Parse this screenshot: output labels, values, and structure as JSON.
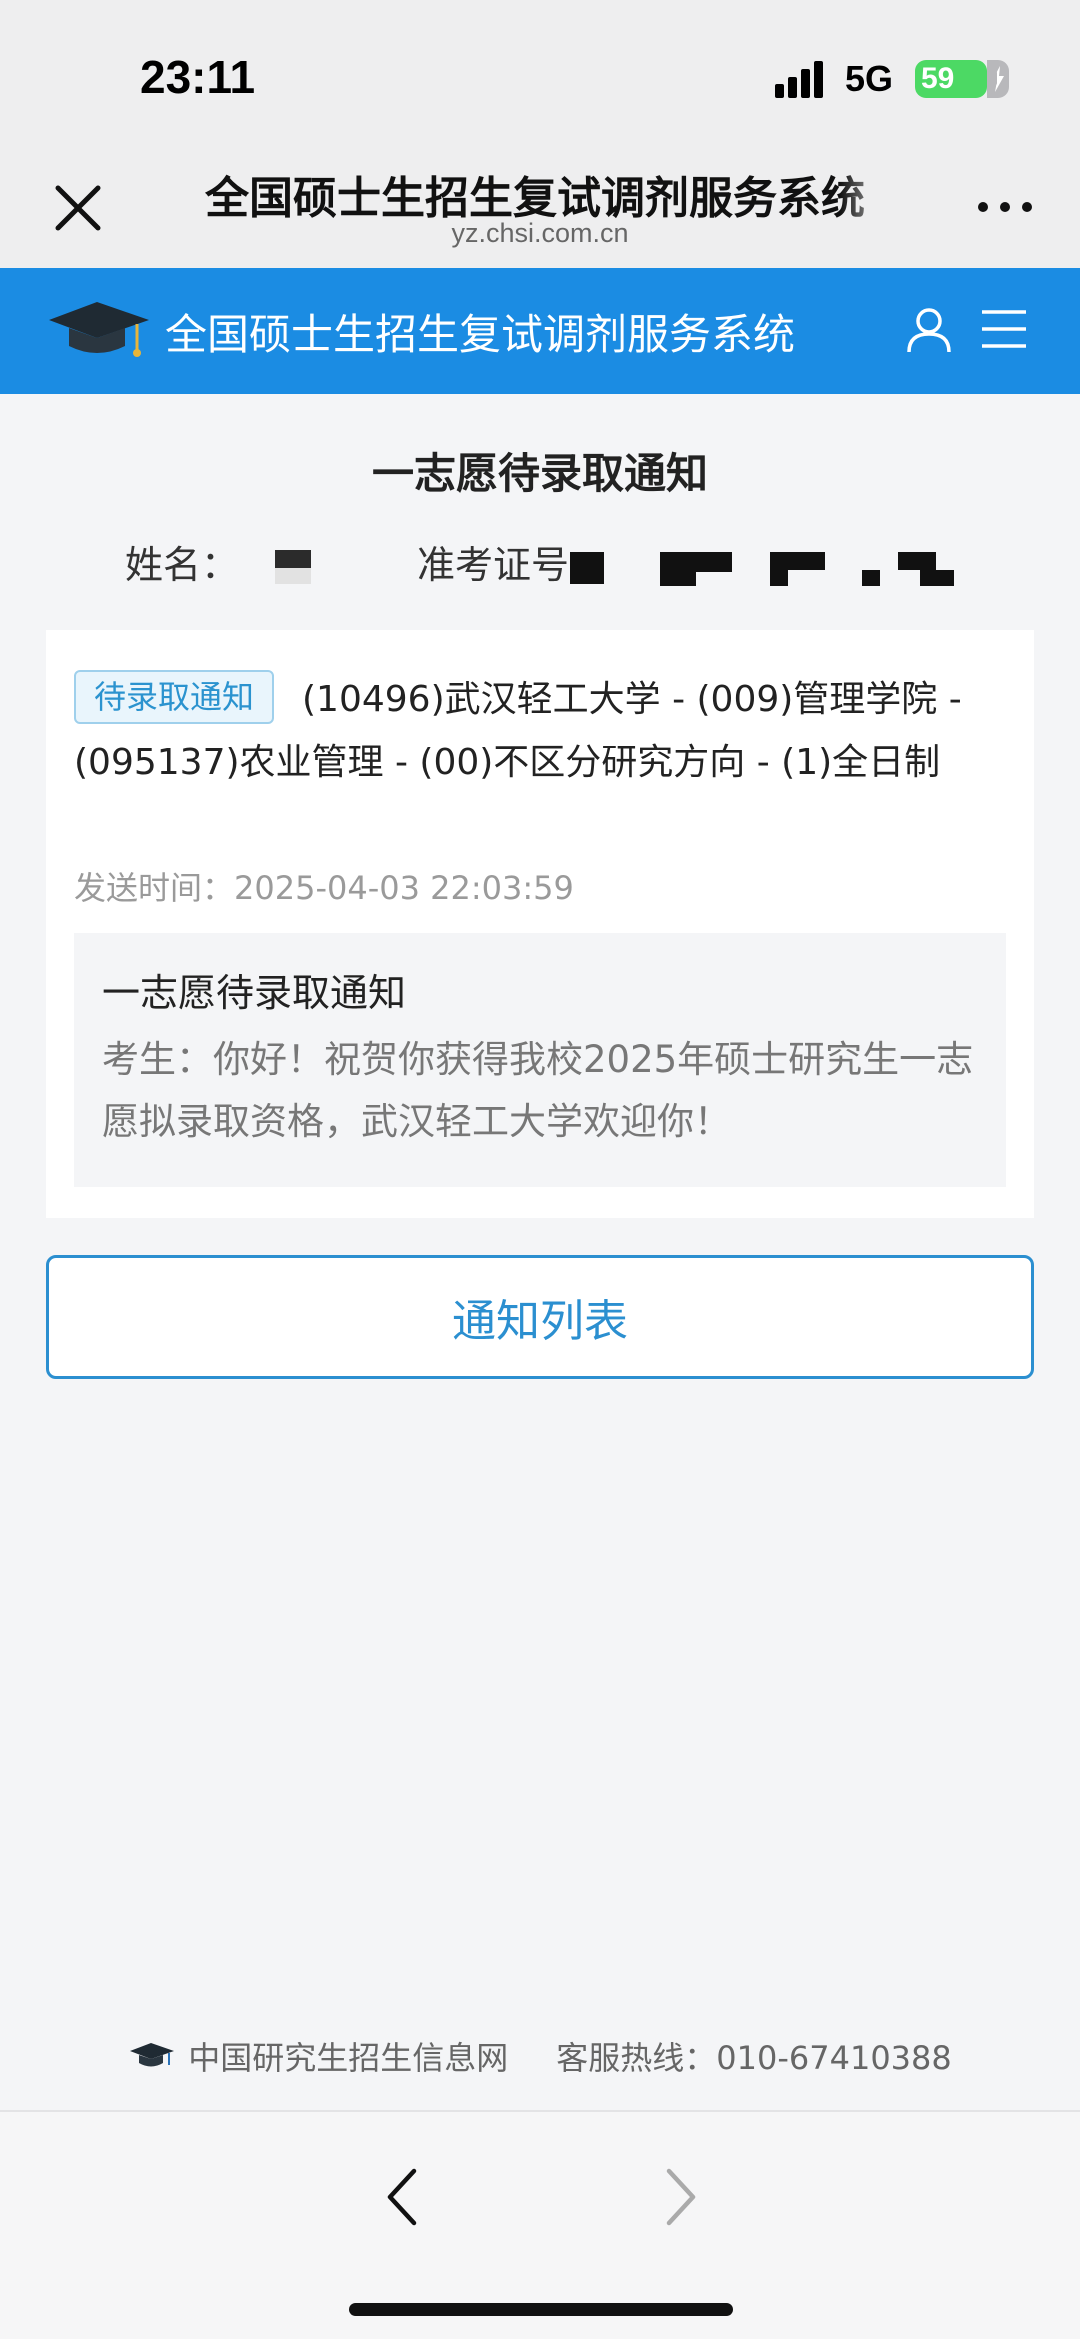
{
  "status_bar": {
    "time": "23:11",
    "network": "5G",
    "battery_level": "59",
    "signal_icon": "signal-bars-icon",
    "battery_color": "#4cd964"
  },
  "webview": {
    "title": "全国硕士生招生复试调剂服务系统",
    "url": "yz.chsi.com.cn",
    "close_icon": "close-icon",
    "more_icon": "more-dots-icon"
  },
  "site_header": {
    "title": "全国硕士生招生复试调剂服务系统",
    "logo_icon": "graduation-cap-icon",
    "user_icon": "user-icon",
    "menu_icon": "menu-icon",
    "background_color": "#1b8ce3"
  },
  "page": {
    "title": "一志愿待录取通知",
    "name_label": "姓名：",
    "exam_id_label": "准考证号"
  },
  "notice": {
    "status_badge": "待录取通知",
    "program": "(10496)武汉轻工大学 - (009)管理学院 - (095137)农业管理 - (00)不区分研究方向 - (1)全日制",
    "send_time_label": "发送时间：",
    "send_time": "2025-04-03 22:03:59",
    "message_title": "一志愿待录取通知",
    "message_content": "考生：你好！祝贺你获得我校2025年硕士研究生一志愿拟录取资格，武汉轻工大学欢迎你！"
  },
  "actions": {
    "notice_list_label": "通知列表",
    "accent_color": "#2b8fd0"
  },
  "footer": {
    "site_name": "中国研究生招生信息网",
    "hotline": "客服热线：010-67410388"
  },
  "bottom_nav": {
    "back_icon": "chevron-left-icon",
    "forward_icon": "chevron-right-icon"
  }
}
